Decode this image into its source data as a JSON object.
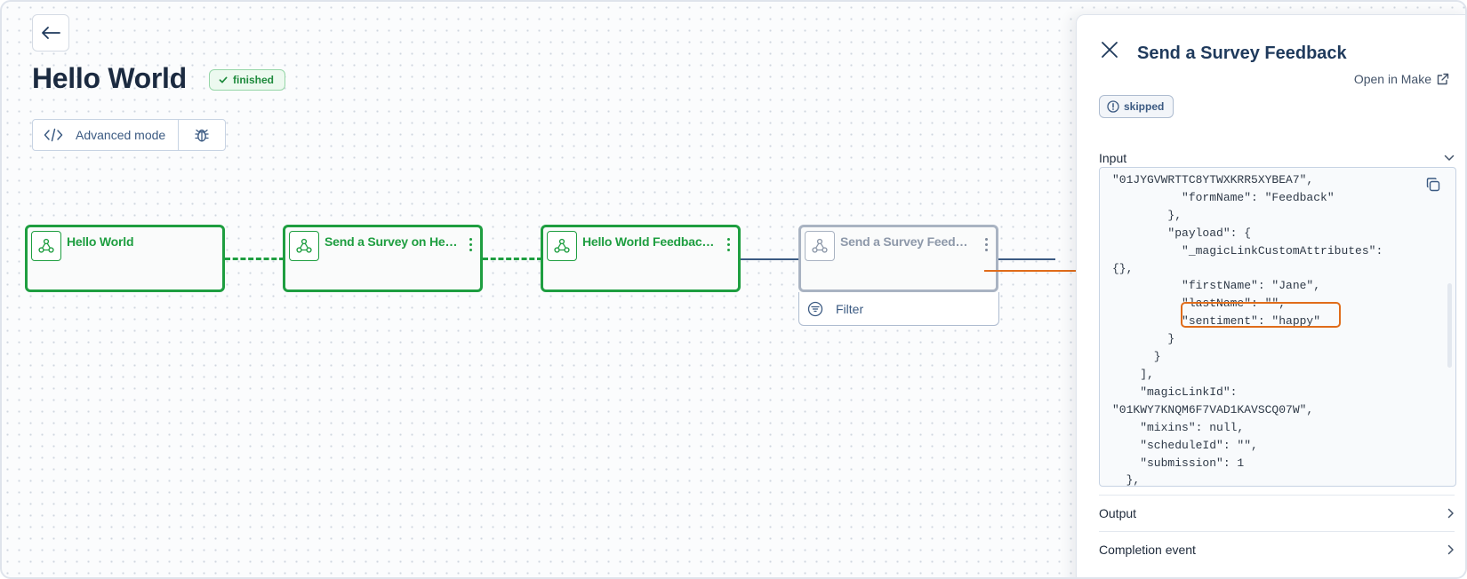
{
  "page": {
    "title": "Hello World",
    "status": "finished",
    "toolbar": {
      "advanced_mode_label": "Advanced mode"
    }
  },
  "flow": {
    "nodes": [
      {
        "label": "Hello World",
        "state": "finished",
        "has_menu": false
      },
      {
        "label": "Send a Survey on Hello World",
        "state": "finished",
        "has_menu": true
      },
      {
        "label": "Hello World Feedback Received",
        "state": "finished",
        "has_menu": true
      },
      {
        "label": "Send a Survey Feedback",
        "state": "skipped",
        "has_menu": true
      }
    ],
    "filter_label": "Filter"
  },
  "panel": {
    "title": "Send a Survey Feedback",
    "open_in_make": "Open in Make",
    "status": "skipped",
    "sections": {
      "input": "Input",
      "output": "Output",
      "completion": "Completion event"
    },
    "input_code": "\"01JYGVWRTTC8YTWXKRR5XYBEA7\",\n          \"formName\": \"Feedback\"\n        },\n        \"payload\": {\n          \"_magicLinkCustomAttributes\":\n{},\n          \"firstName\": \"Jane\",\n          \"lastName\": \"\",\n          \"sentiment\": \"happy\"\n        }\n      }\n    ],\n    \"magicLinkId\":\n\"01KWY7KNQM6F7VAD1KAVSCQ07W\",\n    \"mixins\": null,\n    \"scheduleId\": \"\",\n    \"submission\": 1\n  },"
  },
  "colors": {
    "success": "#1e9e40",
    "accent": "#3b5a82",
    "annotation": "#e06c1a",
    "muted": "#8d98a9"
  },
  "icons": [
    "back-arrow-icon",
    "check-icon",
    "code-icon",
    "bug-icon",
    "webhook-icon",
    "kebab-menu-icon",
    "filter-icon",
    "close-icon",
    "external-link-icon",
    "alert-circle-icon",
    "chevron-down-icon",
    "chevron-right-icon",
    "copy-icon"
  ]
}
